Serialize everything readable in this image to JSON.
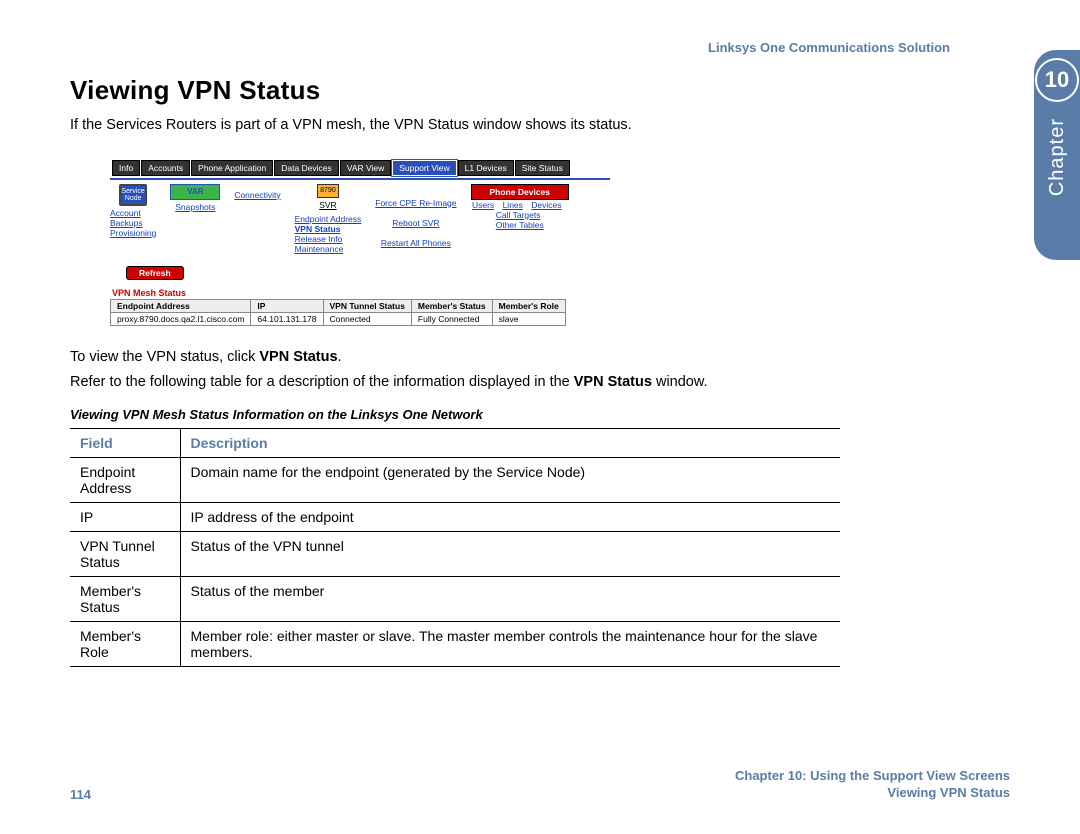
{
  "header": {
    "product": "Linksys One Communications Solution"
  },
  "chapter": {
    "number": "10",
    "label": "Chapter"
  },
  "section": {
    "title": "Viewing VPN Status",
    "intro": "If the Services Routers is part of a VPN mesh, the VPN Status window shows its status.",
    "line1_pre": "To view the VPN status, click ",
    "line1_bold": "VPN Status",
    "line1_post": ".",
    "line2_pre": "Refer to the following table for a description of the information displayed in the ",
    "line2_bold": "VPN Status",
    "line2_post": " window."
  },
  "screenshot": {
    "tabs": [
      "Info",
      "Accounts",
      "Phone Application",
      "Data Devices",
      "VAR View",
      "Support View",
      "L1 Devices",
      "Site Status"
    ],
    "active_tab_index": 5,
    "service_node": "Service Node",
    "service_links": [
      "Account",
      "Backups",
      "Provisioning"
    ],
    "var_label": "VAR",
    "var_links": [
      "Snapshots"
    ],
    "connectivity": "Connectivity",
    "site_label": "8790",
    "site_sub": "SVR",
    "site_links": [
      "Endpoint Address",
      "VPN Status",
      "Release Info",
      "Maintenance"
    ],
    "site_links_bold_index": 1,
    "ops_links": [
      "Force CPE Re-Image",
      "Reboot SVR",
      "Restart All Phones"
    ],
    "phone_header": "Phone Devices",
    "phone_top": [
      "Users",
      "Lines",
      "Devices"
    ],
    "phone_links": [
      "Call Targets",
      "Other Tables"
    ],
    "refresh": "Refresh",
    "mesh_title": "VPN Mesh Status",
    "mesh_headers": [
      "Endpoint Address",
      "IP",
      "VPN Tunnel Status",
      "Member's Status",
      "Member's Role"
    ],
    "mesh_row": [
      "proxy.8790.docs.qa2.l1.cisco.com",
      "64.101.131.178",
      "Connected",
      "Fully Connected",
      "slave"
    ]
  },
  "table": {
    "caption": "Viewing VPN Mesh Status Information on the Linksys One Network",
    "head": [
      "Field",
      "Description"
    ],
    "rows": [
      [
        "Endpoint Address",
        "Domain name for the endpoint (generated by the Service Node)"
      ],
      [
        "IP",
        "IP address of the endpoint"
      ],
      [
        "VPN Tunnel Status",
        "Status of the VPN tunnel"
      ],
      [
        "Member's Status",
        "Status of the member"
      ],
      [
        "Member's Role",
        "Member role: either master or slave. The master member controls the maintenance hour for the slave members."
      ]
    ]
  },
  "footer": {
    "page": "114",
    "line1": "Chapter 10: Using the Support View Screens",
    "line2": "Viewing VPN Status"
  }
}
